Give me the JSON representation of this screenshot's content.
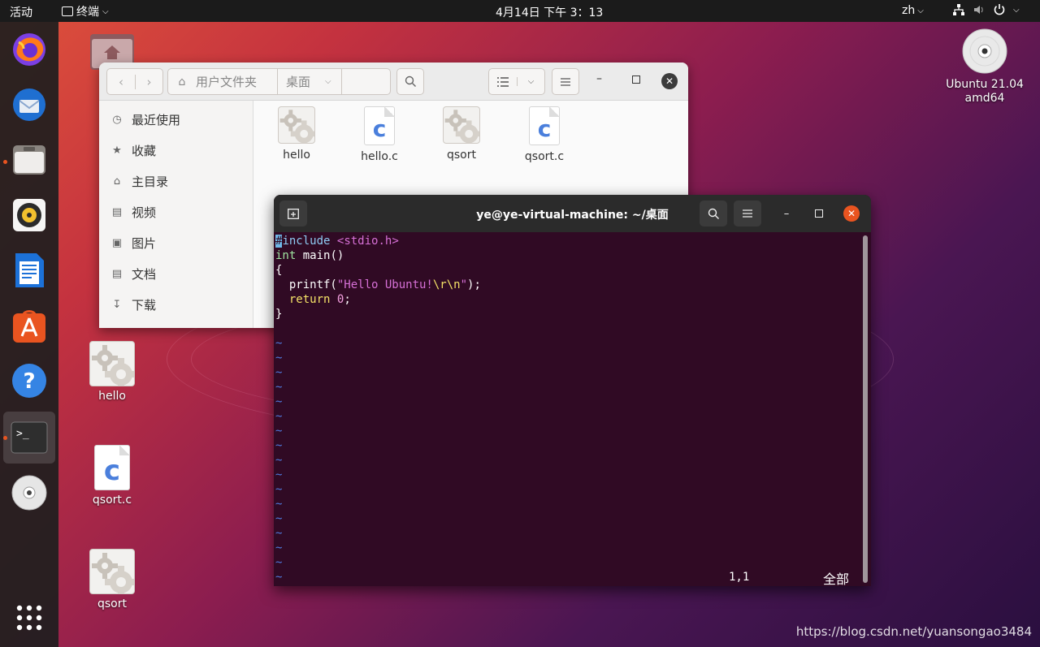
{
  "topbar": {
    "activities": "活动",
    "app_name": "终端",
    "clock": "4月14日  下午 3：13",
    "lang": "zh"
  },
  "dock": {
    "apps": [
      "firefox-icon",
      "thunderbird-icon",
      "files-icon",
      "rhythmbox-icon",
      "libreoffice-writer-icon",
      "software-center-icon",
      "help-icon",
      "terminal-icon",
      "optical-disc-icon",
      "show-applications-icon"
    ],
    "accent": "#e95420"
  },
  "desktop": {
    "icons": [
      {
        "label": "hello"
      },
      {
        "label": "qsort.c"
      },
      {
        "label": "qsort"
      }
    ],
    "drive": {
      "label": "Ubuntu 21.04 amd64"
    }
  },
  "files": {
    "breadcrumb": [
      "用户文件夹",
      "桌面"
    ],
    "sidebar": [
      {
        "label": "最近使用",
        "icon": "clock-icon"
      },
      {
        "label": "收藏",
        "icon": "star-icon"
      },
      {
        "label": "主目录",
        "icon": "home-icon"
      },
      {
        "label": "视频",
        "icon": "film-icon"
      },
      {
        "label": "图片",
        "icon": "image-icon"
      },
      {
        "label": "文档",
        "icon": "document-icon"
      },
      {
        "label": "下载",
        "icon": "download-icon"
      }
    ],
    "items": [
      {
        "label": "hello",
        "type": "executable"
      },
      {
        "label": "hello.c",
        "type": "c-source"
      },
      {
        "label": "qsort",
        "type": "executable"
      },
      {
        "label": "qsort.c",
        "type": "c-source"
      }
    ]
  },
  "terminal": {
    "title": "ye@ye-virtual-machine: ~/桌面",
    "code": {
      "line1_cursor": "#",
      "line1_pp": "include",
      "line1_header": "<stdio.h>",
      "line2": "int main()",
      "line3": "{",
      "line4_fn": "  printf(",
      "line4_str": "\"Hello Ubuntu!",
      "line4_esc": "\\r\\n",
      "line4_end": "\");",
      "line5_kw": "  return",
      "line5_num": "0",
      "line5_end": ";",
      "line6": "}"
    },
    "tilde": "~",
    "status_pos": "1,1",
    "status_all": "全部"
  },
  "watermark": "https://blog.csdn.net/yuansongao3484"
}
